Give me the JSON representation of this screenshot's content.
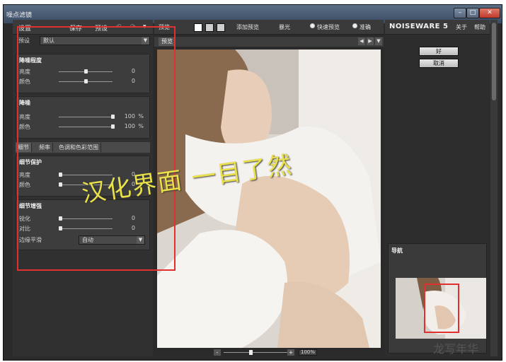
{
  "window": {
    "title": "噪点滤镜",
    "min": "–",
    "max": "□",
    "close": "✕"
  },
  "left": {
    "settings": "设置",
    "save": "保存",
    "presets": "预设",
    "undo": "↶",
    "redo": "↷",
    "menu": "▾",
    "preset_label": "预设",
    "preset_value": "默认",
    "groups": {
      "denoise_level": {
        "title": "降噪程度",
        "rows": [
          {
            "label": "亮度",
            "value": "0"
          },
          {
            "label": "颜色",
            "value": "0"
          }
        ]
      },
      "denoise": {
        "title": "降噪",
        "rows": [
          {
            "label": "亮度",
            "value": "100",
            "unit": "%"
          },
          {
            "label": "颜色",
            "value": "100",
            "unit": "%"
          }
        ]
      },
      "tabs": [
        "细节",
        "频率",
        "色调和色彩范围"
      ],
      "detail_protect": {
        "title": "细节保护",
        "rows": [
          {
            "label": "亮度",
            "value": "0"
          },
          {
            "label": "颜色",
            "value": "0"
          }
        ]
      },
      "detail_enhance": {
        "title": "细节增强",
        "rows": [
          {
            "label": "锐化",
            "value": "0"
          },
          {
            "label": "对比",
            "value": "0"
          }
        ],
        "edge_label": "边缘平滑",
        "edge_value": "自动"
      }
    }
  },
  "center": {
    "preview": "预览",
    "add_preview": "添加预览",
    "exposure": "暴光",
    "fast_preview": "快速预览",
    "accurate": "准确",
    "tab_label": "预览",
    "zoom_pct": "100%",
    "zoom_minus": "-",
    "zoom_plus": "+"
  },
  "right": {
    "brand": "NOISEWARE 5",
    "about": "关于",
    "help": "帮助",
    "ok": "好",
    "cancel": "取消",
    "nav": "导航"
  },
  "overlay_text": "汉化界面 一目了然",
  "watermark": "龙写年华",
  "colors": {
    "highlight": "#e03030",
    "overlay": "#e9e04a"
  }
}
